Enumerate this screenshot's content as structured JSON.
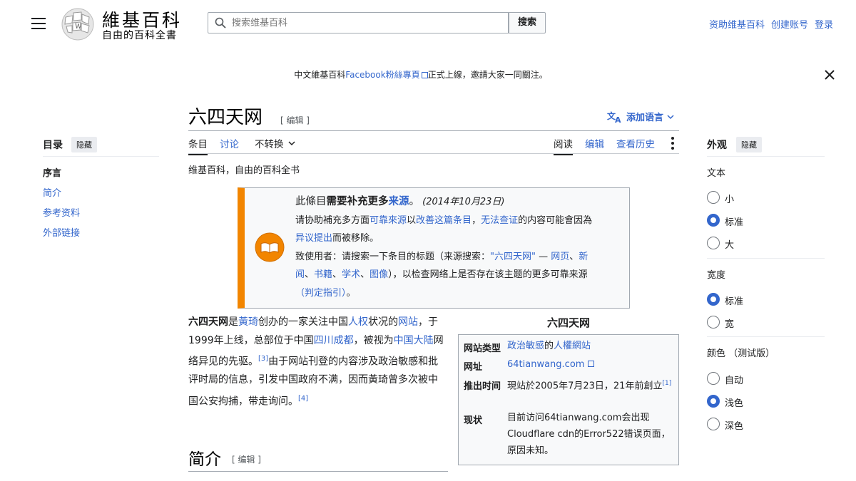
{
  "header": {
    "logo_title": "維基百科",
    "logo_tagline": "自由的百科全書",
    "search_placeholder": "搜索维基百科",
    "search_button": "搜索",
    "user_links": [
      "资助维基百科",
      "创建账号",
      "登录"
    ]
  },
  "banner": {
    "before": "中文維基百科",
    "link": "Facebook粉絲專頁",
    "after": "正式上線，邀請大家一同關注。"
  },
  "page": {
    "title": "六四天网",
    "edit_label": "[ 编辑 ]",
    "add_languages": "添加语言",
    "tagline": "维基百科，自由的百科全书"
  },
  "tabs": {
    "left": [
      "条目",
      "讨论",
      "不转换"
    ],
    "right": [
      "阅读",
      "编辑",
      "查看历史"
    ]
  },
  "toc": {
    "title": "目录",
    "hide": "隐藏",
    "items": [
      "序言",
      "简介",
      "参考资料",
      "外部链接"
    ]
  },
  "ambox": {
    "line1_pre": "此條目",
    "line1_bold": "需要补充更多",
    "line1_link": "来源",
    "line1_end": "。",
    "line1_date": "(2014年10月23日)",
    "line2_a": "请协助補充多方面",
    "line2_l1": "可靠來源",
    "line2_b": "以",
    "line2_l2": "改善这篇条目",
    "line2_c": "，",
    "line2_l3": "无法查证",
    "line2_d": "的内容可能會因為",
    "line3_l": "异议提出",
    "line3_b": "而被移除。",
    "line4_a": "致使用者：请搜索一下条目的标题（来源搜索：",
    "line4_l1": "\"六四天网\"",
    "line4_dash": " — ",
    "line4_l2": "网页",
    "line4_sep": "、",
    "line4_l3": "新",
    "line5_l1": "闻",
    "line5_l2": "书籍",
    "line5_l3": "学术",
    "line5_l4": "图像",
    "line5_b": "），以检查网络上是否存在该主题的更多可靠来源",
    "line6_l": "（判定指引）",
    "line6_end": "。"
  },
  "lead": {
    "t1": "六四天网",
    "t2": "是",
    "l1": "黃琦",
    "t3": "创办的一家关注中国",
    "l2": "人权",
    "t4": "状况的",
    "l3": "网站",
    "t5": "，于1999年上线，总部位于中国",
    "l4": "四川",
    "l5": "成都",
    "t6": "，被视为",
    "l6": "中国大陆",
    "t7": "网络异见的先驱。",
    "ref1": "[3]",
    "t8": "由于网站刊登的内容涉及政治敏感和批评时局的信息，引发中国政府不满，因而黃琦曾多次被中国公安拘捕，带走询问。",
    "ref2": "[4]"
  },
  "section": {
    "title": "简介",
    "edit": "[ 编辑 ]"
  },
  "infobox": {
    "title": "六四天网",
    "rows": [
      {
        "key": "网站类型",
        "v1": "政治敏感",
        "v2": "的",
        "v3": "人權網站"
      },
      {
        "key": "网址",
        "v1": "64tianwang.com"
      },
      {
        "key": "推出时间",
        "v1": "現站於2005年7月23日，21年前創立",
        "ref": "[1]"
      },
      {
        "key": "现状",
        "v1": "目前访问64tianwang.com会出现Cloudflare cdn的Error522错误页面，原因未知。"
      }
    ]
  },
  "appearance": {
    "title": "外观",
    "hide": "隐藏",
    "text_label": "文本",
    "text_options": [
      "小",
      "标准",
      "大"
    ],
    "width_label": "宽度",
    "width_options": [
      "标准",
      "宽"
    ],
    "color_label": "颜色 （测试版）",
    "color_options": [
      "自动",
      "浅色",
      "深色"
    ],
    "selected": {
      "text": "标准",
      "width": "标准",
      "color": "浅色"
    }
  },
  "colors": {
    "link": "#3366cc",
    "ambox_border": "#f28500",
    "radio_on": "#3366cc"
  }
}
